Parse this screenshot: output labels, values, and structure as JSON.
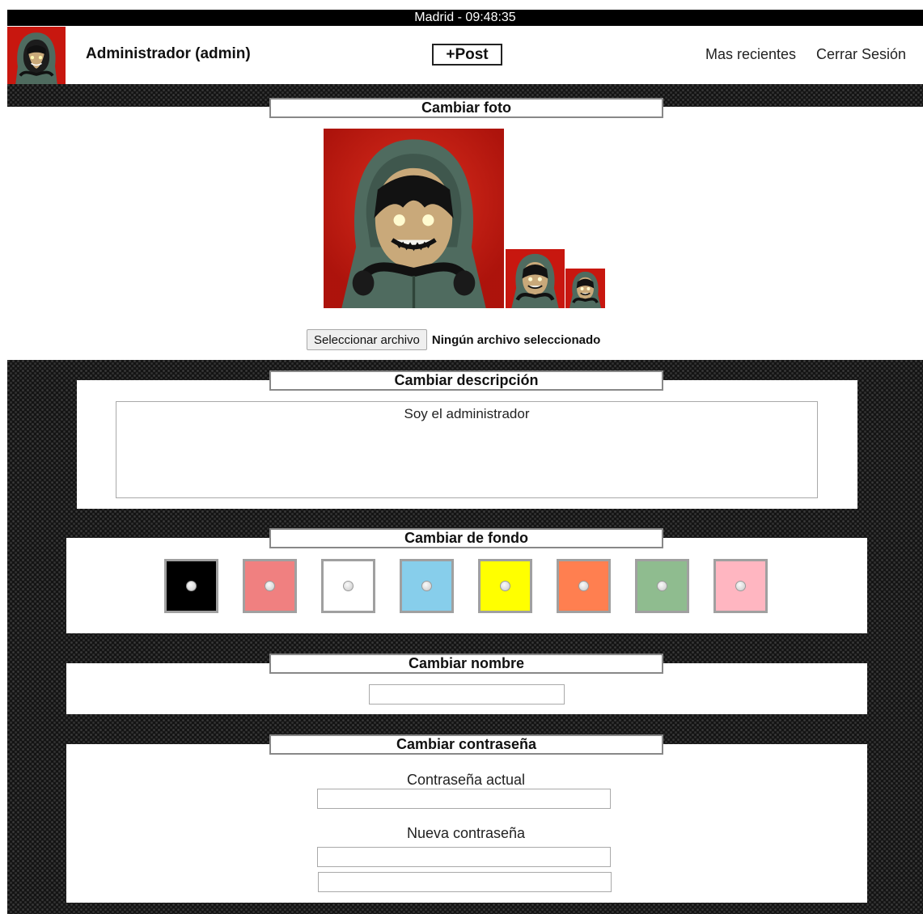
{
  "clock": {
    "text": "Madrid - 09:48:35"
  },
  "header": {
    "user_name": "Administrador (admin)",
    "post_label": "+Post",
    "recent_label": "Mas recientes",
    "logout_label": "Cerrar Sesión"
  },
  "photo_section": {
    "title": "Cambiar foto",
    "file_button_label": "Seleccionar archivo",
    "file_status": "Ningún archivo seleccionado"
  },
  "description_section": {
    "title": "Cambiar descripción",
    "value": "Soy el administrador"
  },
  "background_section": {
    "title": "Cambiar de fondo",
    "swatches": [
      "#000000",
      "#f08080",
      "#ffffff",
      "#87ceeb",
      "#ffff00",
      "#ff7f50",
      "#8fbc8f",
      "#ffb6c1"
    ]
  },
  "name_section": {
    "title": "Cambiar nombre",
    "value": ""
  },
  "password_section": {
    "title": "Cambiar contraseña",
    "current_label": "Contraseña actual",
    "new_label": "Nueva contraseña"
  },
  "colors": {
    "header_bg": "#ffffff",
    "clock_bg": "#000000",
    "section_border": "#888888",
    "avatar_red": "#c8170f",
    "hood_green": "#4f6b5f"
  }
}
